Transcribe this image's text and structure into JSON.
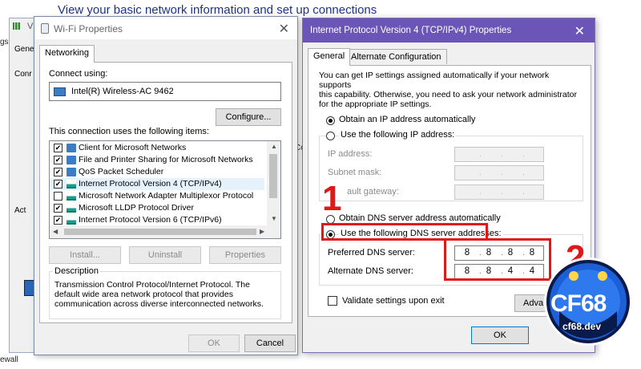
{
  "background": {
    "title": "View your basic network information and set up connections",
    "side_labels": [
      "gs",
      "Co",
      "Act",
      "ewall"
    ]
  },
  "back_window": {
    "title_fragment": "V",
    "tab_fragment": "Gene",
    "label_fragment": "Conr"
  },
  "wifi_dialog": {
    "title": "Wi-Fi Properties",
    "tab": "Networking",
    "connect_using_label": "Connect using:",
    "adapter": "Intel(R) Wireless-AC 9462",
    "configure_button": "Configure...",
    "items_label": "This connection uses the following items:",
    "items": [
      {
        "label": "Client for Microsoft Networks",
        "checked": true,
        "icon": "network-client-icon"
      },
      {
        "label": "File and Printer Sharing for Microsoft Networks",
        "checked": true,
        "icon": "network-service-icon"
      },
      {
        "label": "QoS Packet Scheduler",
        "checked": true,
        "icon": "network-service-icon"
      },
      {
        "label": "Internet Protocol Version 4 (TCP/IPv4)",
        "checked": true,
        "icon": "protocol-icon"
      },
      {
        "label": "Microsoft Network Adapter Multiplexor Protocol",
        "checked": false,
        "icon": "protocol-icon"
      },
      {
        "label": "Microsoft LLDP Protocol Driver",
        "checked": true,
        "icon": "protocol-icon"
      },
      {
        "label": "Internet Protocol Version 6 (TCP/IPv6)",
        "checked": true,
        "icon": "protocol-icon"
      }
    ],
    "install_button": "Install...",
    "uninstall_button": "Uninstall",
    "properties_button": "Properties",
    "description_title": "Description",
    "description_text": "Transmission Control Protocol/Internet Protocol. The default wide area network protocol that provides communication across diverse interconnected networks.",
    "ok_button": "OK",
    "cancel_button": "Cancel"
  },
  "ipv4_dialog": {
    "title": "Internet Protocol Version 4 (TCP/IPv4) Properties",
    "tabs": [
      "General",
      "Alternate Configuration"
    ],
    "intro": "You can get IP settings assigned automatically if your network supports this capability. Otherwise, you need to ask your network administrator for the appropriate IP settings.",
    "intro_lines": [
      "You can get IP settings assigned automatically if your network supports",
      "this capability. Otherwise, you need to ask your network administrator",
      "for the appropriate IP settings."
    ],
    "obtain_ip_auto": "Obtain an IP address automatically",
    "use_following_ip": "Use the following IP address:",
    "ip_address_label": "IP address:",
    "subnet_mask_label": "Subnet mask:",
    "default_gateway_label": "ault gateway:",
    "obtain_dns_auto": "Obtain DNS server address automatically",
    "use_following_dns": "Use the following DNS server addresses:",
    "preferred_dns_label": "Preferred DNS server:",
    "alternate_dns_label": "Alternate DNS server:",
    "preferred_dns": [
      "8",
      "8",
      "8",
      "8"
    ],
    "alternate_dns": [
      "8",
      "8",
      "4",
      "4"
    ],
    "validate_label": "Validate settings upon exit",
    "advanced_button": "Adva",
    "ok_button": "OK",
    "selected": {
      "ip_mode": "auto",
      "dns_mode": "manual"
    }
  },
  "annotations": {
    "step1": "1",
    "step2": "2",
    "color": "#e01818"
  },
  "logo": {
    "name": "CF68",
    "url_text": "cf68.dev",
    "colors": {
      "primary": "#1c5fd6",
      "dark": "#0a1a4a"
    }
  }
}
